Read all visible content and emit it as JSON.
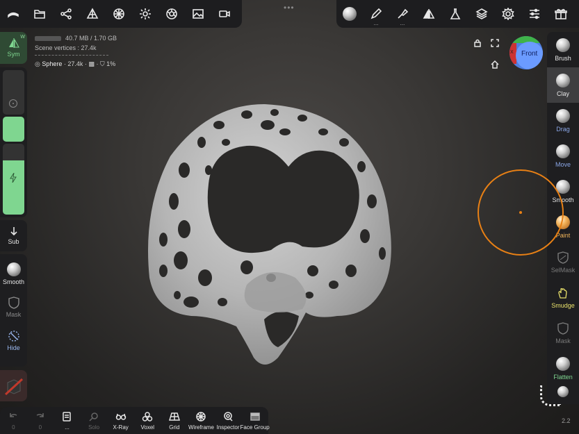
{
  "topbar": {
    "left_icons": [
      "scene-hierarchy-icon",
      "folder-icon",
      "share-icon",
      "pyramid-icon",
      "material-icon",
      "light-icon",
      "post-process-icon",
      "background-image-icon",
      "camera-icon"
    ],
    "right_icons": [
      "matcap-icon",
      "pen-icon",
      "stroke-icon",
      "symmetry-icon",
      "flask-icon",
      "layers-icon",
      "settings-icon",
      "sliders-icon",
      "gift-icon"
    ]
  },
  "info": {
    "memory": "40.7 MB / 1.70 GB",
    "vertices_label": "Scene vertices : 27.4k",
    "object_name": "Sphere",
    "object_stats": "· 27.4k · ▩ · ⛉ 1%"
  },
  "left_panel": {
    "sym_label": "Sym",
    "w_tag": "W",
    "sub_label": "Sub",
    "tools": [
      {
        "label": "Smooth",
        "color": "#e6e6e6"
      },
      {
        "label": "Mask",
        "color": "#8a8a8a"
      },
      {
        "label": "Hide",
        "color": "#9bb8f0"
      }
    ]
  },
  "gizmo": {
    "face": "Front",
    "axis": "X"
  },
  "right_tools": [
    {
      "label": "Brush",
      "color": "#e6e6e6",
      "active": false
    },
    {
      "label": "Clay",
      "color": "#e6e6e6",
      "active": true
    },
    {
      "label": "Drag",
      "color": "#8aa6e6",
      "active": false
    },
    {
      "label": "Move",
      "color": "#8aa6e6",
      "active": false
    },
    {
      "label": "Smooth",
      "color": "#e6e6e6",
      "active": false
    },
    {
      "label": "Paint",
      "color": "#f0b45a",
      "active": false
    },
    {
      "label": "SelMask",
      "color": "#7a7a7a",
      "active": false
    },
    {
      "label": "Smudge",
      "color": "#e8e06a",
      "active": false
    },
    {
      "label": "Mask",
      "color": "#7a7a7a",
      "active": false
    },
    {
      "label": "Flatten",
      "color": "#7fd690",
      "active": false
    }
  ],
  "bottombar": {
    "undo_count": "0",
    "redo_count": "0",
    "menu_label": "...",
    "solo_label": "Solo",
    "xray_label": "X-Ray",
    "voxel_label": "Voxel",
    "grid_label": "Grid",
    "wireframe_label": "Wireframe",
    "inspector_label": "Inspector",
    "facegroup_label": "Face Group"
  },
  "version": "2.2",
  "colors": {
    "accent": "#7fd690",
    "brush_circle": "#e88015",
    "panel": "#1e1e20"
  }
}
